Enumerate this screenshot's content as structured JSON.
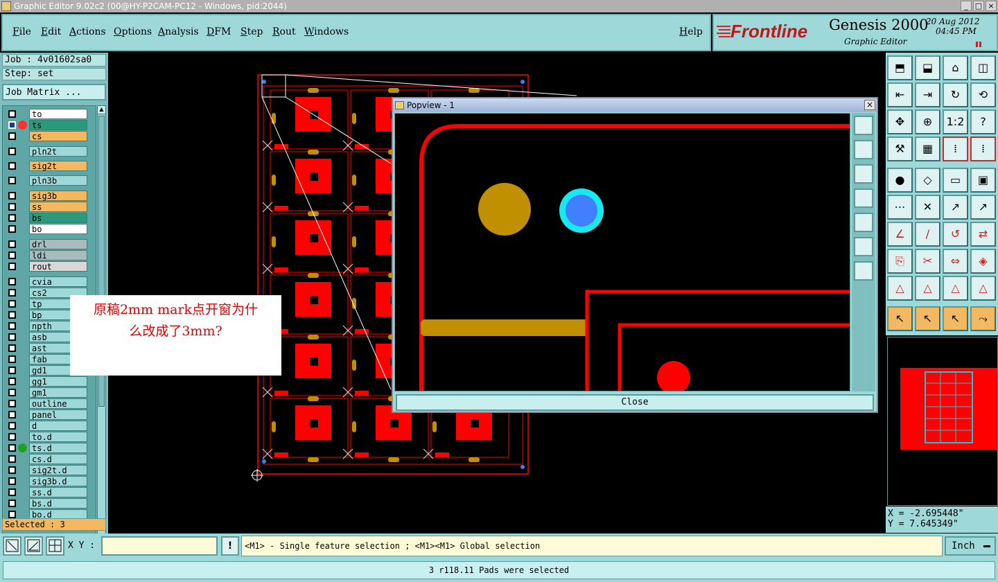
{
  "window": {
    "title": "Graphic Editor 9.02c2 (00@HY-P2CAM-PC12 - Windows, pid:2044)",
    "minimize": "_",
    "maximize": "□",
    "close": "×"
  },
  "menubar": {
    "items": [
      "File",
      "Edit",
      "Actions",
      "Options",
      "Analysis",
      "DFM",
      "Step",
      "Rout",
      "Windows"
    ],
    "help": "Help"
  },
  "brand": {
    "logo": "Frontline",
    "product": "Genesis 2000",
    "subtitle": "Graphic Editor",
    "date": "20 Aug 2012",
    "time": "04:45 PM"
  },
  "job": {
    "job_label": "Job : 4v01602sa0",
    "step_label": "Step: set",
    "matrix_button": "Job Matrix ..."
  },
  "layers": [
    {
      "name": "to",
      "bg": "#ffffff",
      "active": false
    },
    {
      "name": "ts",
      "bg": "#2a9a7a",
      "active": true
    },
    {
      "name": "cs",
      "bg": "#f4b860",
      "active": false
    },
    {
      "name": "pln2t",
      "bg": "#9fd8d8",
      "active": false
    },
    {
      "name": "sig2t",
      "bg": "#f4b860",
      "active": false
    },
    {
      "name": "pln3b",
      "bg": "#9fd8d8",
      "active": false
    },
    {
      "name": "sig3b",
      "bg": "#f4b860",
      "active": false
    },
    {
      "name": "ss",
      "bg": "#f4b860",
      "active": false
    },
    {
      "name": "bs",
      "bg": "#2a9a7a",
      "active": false
    },
    {
      "name": "bo",
      "bg": "#ffffff",
      "active": false
    },
    {
      "name": "drl",
      "bg": "#a8bcbc",
      "active": false
    },
    {
      "name": "ldi",
      "bg": "#a8bcbc",
      "active": false
    },
    {
      "name": "rout",
      "bg": "#d8d8d8",
      "active": false
    },
    {
      "name": "cvia",
      "bg": "#9fd8d8",
      "active": false
    },
    {
      "name": "cs2",
      "bg": "#9fd8d8",
      "active": false
    },
    {
      "name": "tp",
      "bg": "#9fd8d8",
      "active": false
    },
    {
      "name": "bp",
      "bg": "#9fd8d8",
      "active": false
    },
    {
      "name": "npth",
      "bg": "#9fd8d8",
      "active": false
    },
    {
      "name": "asb",
      "bg": "#9fd8d8",
      "active": false
    },
    {
      "name": "ast",
      "bg": "#9fd8d8",
      "active": false
    },
    {
      "name": "fab",
      "bg": "#9fd8d8",
      "active": false
    },
    {
      "name": "gd1",
      "bg": "#9fd8d8",
      "active": false
    },
    {
      "name": "gg1",
      "bg": "#9fd8d8",
      "active": false
    },
    {
      "name": "gm1",
      "bg": "#9fd8d8",
      "active": false
    },
    {
      "name": "outline",
      "bg": "#9fd8d8",
      "active": false
    },
    {
      "name": "panel",
      "bg": "#9fd8d8",
      "active": false
    },
    {
      "name": "d",
      "bg": "#9fd8d8",
      "active": false
    },
    {
      "name": "to.d",
      "bg": "#9fd8d8",
      "active": false
    },
    {
      "name": "ts.d",
      "bg": "#9fd8d8",
      "active": false
    },
    {
      "name": "cs.d",
      "bg": "#9fd8d8",
      "active": false
    },
    {
      "name": "sig2t.d",
      "bg": "#9fd8d8",
      "active": false
    },
    {
      "name": "sig3b.d",
      "bg": "#9fd8d8",
      "active": false
    },
    {
      "name": "ss.d",
      "bg": "#9fd8d8",
      "active": false
    },
    {
      "name": "bs.d",
      "bg": "#9fd8d8",
      "active": false
    },
    {
      "name": "bo.d",
      "bg": "#9fd8d8",
      "active": false
    }
  ],
  "selected_label": "Selected : 3",
  "popview": {
    "title": "Popview - 1",
    "close_button": "Close"
  },
  "annotation": {
    "line1": "原稿2mm mark点开窗为什",
    "line2": "么改成了3mm?"
  },
  "coords": {
    "x": "X = -2.695448\"",
    "y": "Y = 7.645349\""
  },
  "bottom": {
    "xy_label": "X Y :",
    "xy_value": "",
    "hint": "<M1> - Single feature selection ; <M1><M1> Global selection",
    "units": "Inch"
  },
  "status": "3 r118.11 Pads were selected",
  "toolbar_tools": [
    "zoom-home-icon",
    "zoom-home-icon",
    "home-icon",
    "window-icon",
    "pan-left-icon",
    "pan-right-icon",
    "redraw-icon",
    "snap-icon",
    "fit-icon",
    "center-icon",
    "ratio-icon",
    "help-icon",
    "measure-icon",
    "grid-icon",
    "layers-icon",
    "layers-icon",
    "add-pad-icon",
    "add-line-icon",
    "ruler-icon",
    "select-pad-icon",
    "connect-icon",
    "delete-icon",
    "move-icon",
    "move-icon",
    "angle-icon",
    "line-icon",
    "rotate-icon",
    "flip-icon",
    "copy-icon",
    "cut-icon",
    "resize-icon",
    "shapes-icon",
    "arc-icon",
    "arc-icon",
    "arc-icon",
    "arc-icon",
    "pointer-icon",
    "pointer-icon",
    "pointer-icon",
    "route-icon"
  ],
  "colors": {
    "copper": "#ff0000",
    "gold": "#c09000",
    "via_ring": "#18e8f0",
    "via_hole": "#4080ff",
    "panel_bg": "#9fd8d8"
  }
}
